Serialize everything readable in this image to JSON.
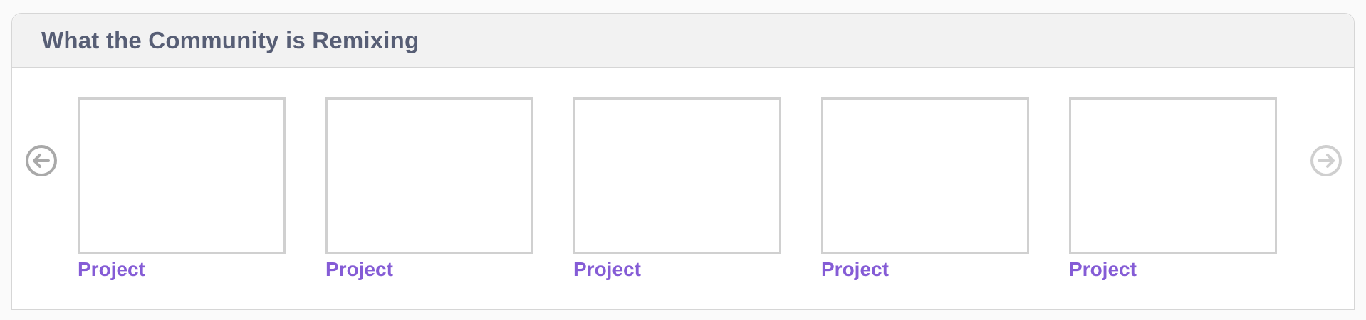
{
  "section": {
    "title": "What the Community is Remixing"
  },
  "carousel": {
    "prev_icon": "arrow-left-circle-icon",
    "next_icon": "arrow-right-circle-icon",
    "prev_color": "#a9a9a9",
    "next_color": "#cfcfcf",
    "items": [
      {
        "title": "Project"
      },
      {
        "title": "Project"
      },
      {
        "title": "Project"
      },
      {
        "title": "Project"
      },
      {
        "title": "Project"
      }
    ]
  },
  "colors": {
    "title": "#575e75",
    "link": "#855cd6",
    "thumb_border": "#d0d0d0",
    "header_bg": "#f2f2f2"
  }
}
